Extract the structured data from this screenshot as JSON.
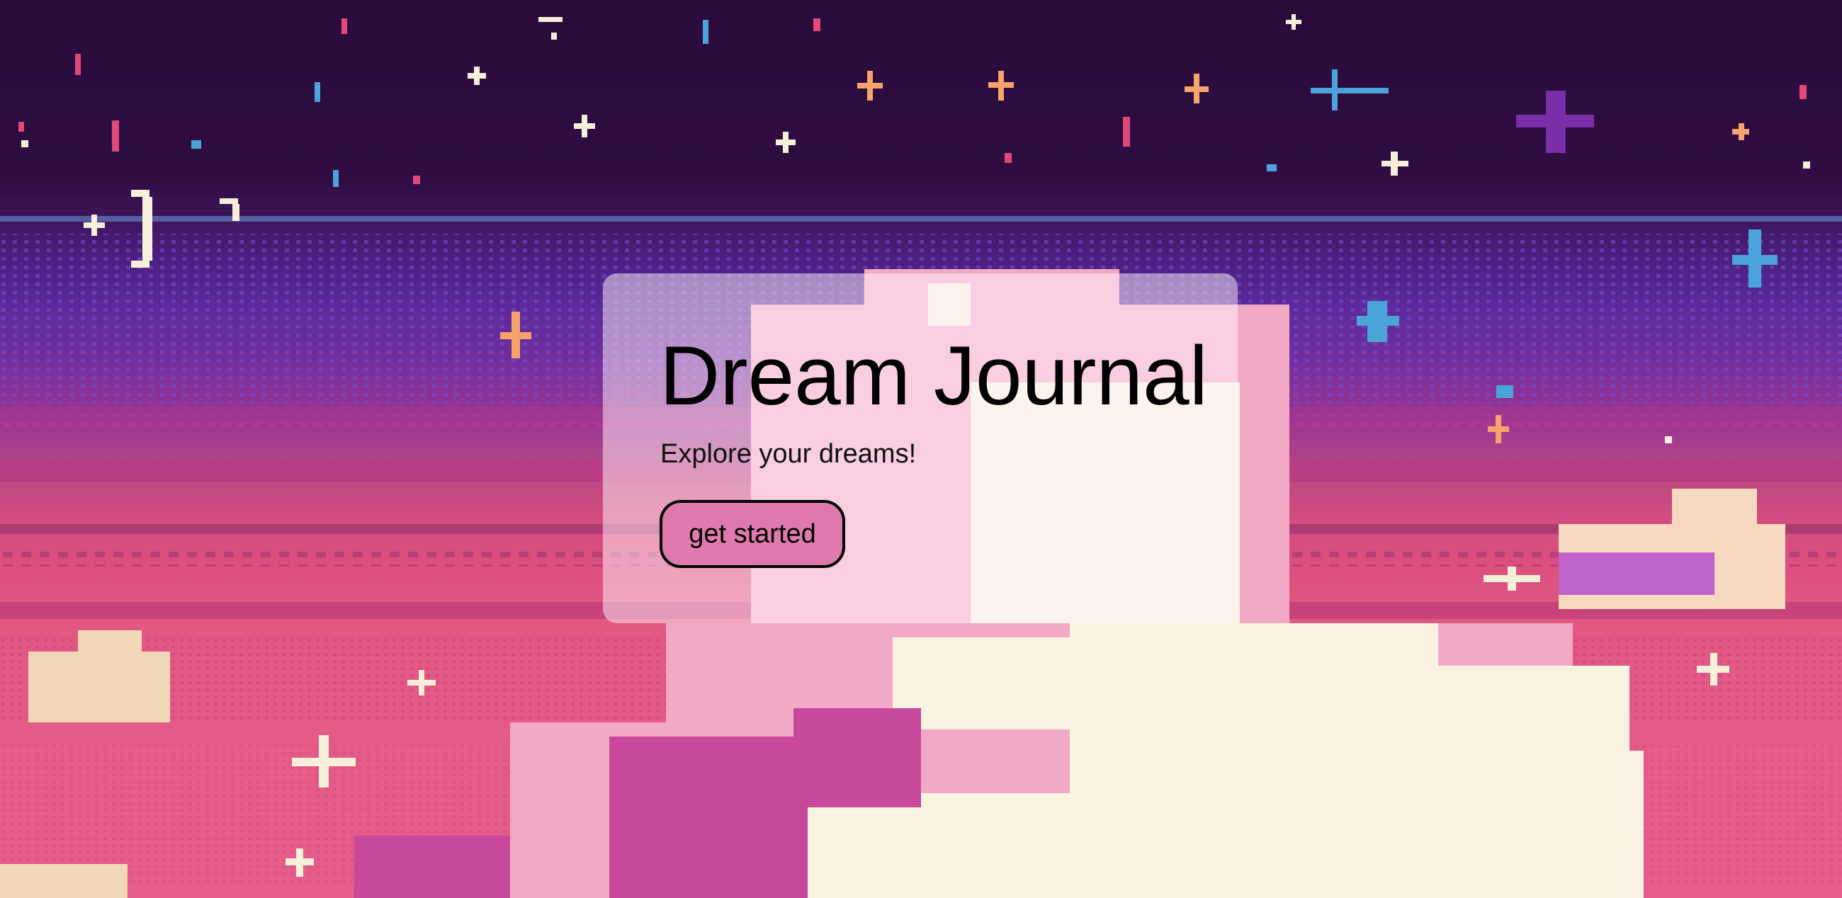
{
  "hero": {
    "title": "Dream Journal",
    "subtitle": "Explore your dreams!",
    "cta_label": "get started"
  },
  "background": {
    "icon": "pixel-art-night-sky-clouds",
    "colors": {
      "night_sky": "#2a0b3a",
      "horizon_purple": "#5a2a9a",
      "sunset_pink": "#dc4f7f",
      "cloud_cream": "#fbf3e2",
      "cloud_pink": "#f2a9c6"
    }
  },
  "colors": {
    "card_overlay": "rgba(255,244,250,0.5)",
    "button_fill": "#e07aae",
    "button_border": "#000000",
    "text": "#000000"
  }
}
